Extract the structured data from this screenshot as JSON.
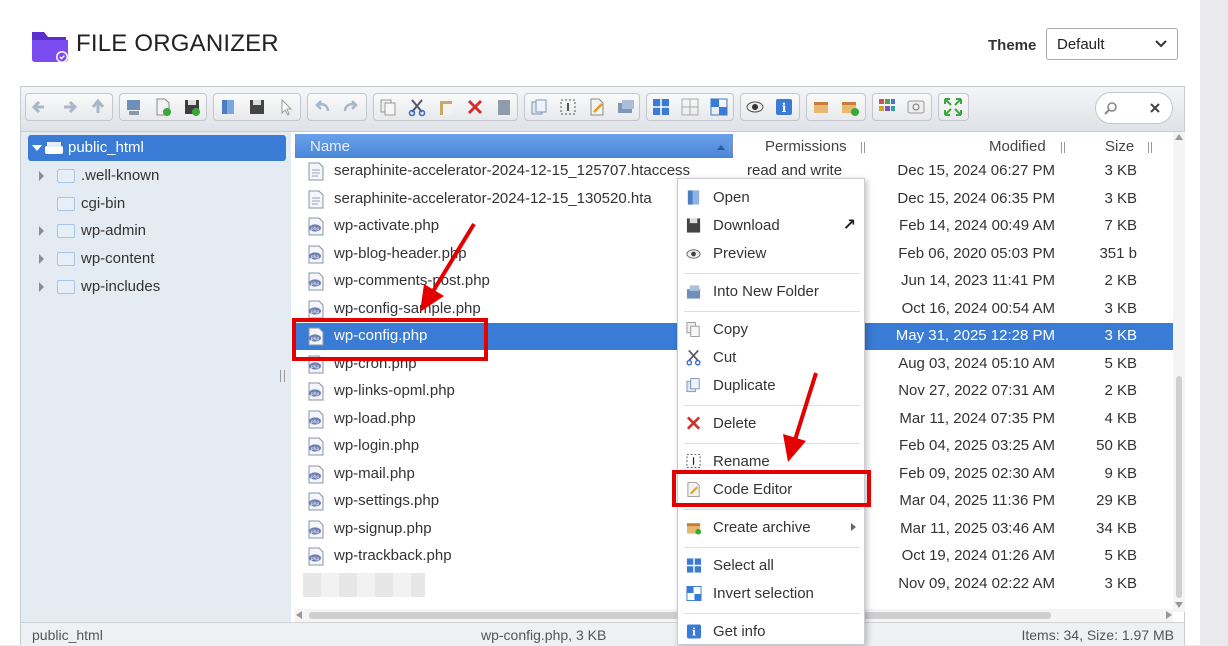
{
  "app": {
    "title": "FILE ORGANIZER"
  },
  "theme": {
    "label": "Theme",
    "value": "Default"
  },
  "tree": {
    "root": "public_html",
    "items": [
      {
        "label": ".well-known",
        "expandable": true
      },
      {
        "label": "cgi-bin",
        "expandable": false
      },
      {
        "label": "wp-admin",
        "expandable": true
      },
      {
        "label": "wp-content",
        "expandable": true
      },
      {
        "label": "wp-includes",
        "expandable": true
      }
    ]
  },
  "columns": {
    "name": "Name",
    "permissions": "Permissions",
    "modified": "Modified",
    "size": "Size"
  },
  "files": [
    {
      "name": "seraphinite-accelerator-2024-12-15_125707.htaccess",
      "perm": "read and write",
      "modified": "Dec 15, 2024 06:27 PM",
      "size": "3 KB",
      "type": "text"
    },
    {
      "name": "seraphinite-accelerator-2024-12-15_130520.hta",
      "perm": "",
      "modified": "Dec 15, 2024 06:35 PM",
      "size": "3 KB",
      "type": "text"
    },
    {
      "name": "wp-activate.php",
      "perm": "",
      "modified": "Feb 14, 2024 00:49 AM",
      "size": "7 KB",
      "type": "php"
    },
    {
      "name": "wp-blog-header.php",
      "perm": "",
      "modified": "Feb 06, 2020 05:03 PM",
      "size": "351 b",
      "type": "php"
    },
    {
      "name": "wp-comments-post.php",
      "perm": "",
      "modified": "Jun 14, 2023 11:41 PM",
      "size": "2 KB",
      "type": "php"
    },
    {
      "name": "wp-config-sample.php",
      "perm": "",
      "modified": "Oct 16, 2024 00:54 AM",
      "size": "3 KB",
      "type": "php"
    },
    {
      "name": "wp-config.php",
      "perm": "",
      "modified": "May 31, 2025 12:28 PM",
      "size": "3 KB",
      "type": "php",
      "selected": true
    },
    {
      "name": "wp-cron.php",
      "perm": "",
      "modified": "Aug 03, 2024 05:10 AM",
      "size": "5 KB",
      "type": "php"
    },
    {
      "name": "wp-links-opml.php",
      "perm": "",
      "modified": "Nov 27, 2022 07:31 AM",
      "size": "2 KB",
      "type": "php"
    },
    {
      "name": "wp-load.php",
      "perm": "",
      "modified": "Mar 11, 2024 07:35 PM",
      "size": "4 KB",
      "type": "php"
    },
    {
      "name": "wp-login.php",
      "perm": "",
      "modified": "Feb 04, 2025 03:25 AM",
      "size": "50 KB",
      "type": "php"
    },
    {
      "name": "wp-mail.php",
      "perm": "",
      "modified": "Feb 09, 2025 02:30 AM",
      "size": "9 KB",
      "type": "php"
    },
    {
      "name": "wp-settings.php",
      "perm": "",
      "modified": "Mar 04, 2025 11:36 PM",
      "size": "29 KB",
      "type": "php"
    },
    {
      "name": "wp-signup.php",
      "perm": "",
      "modified": "Mar 11, 2025 03:46 AM",
      "size": "34 KB",
      "type": "php"
    },
    {
      "name": "wp-trackback.php",
      "perm": "",
      "modified": "Oct 19, 2024 01:26 AM",
      "size": "5 KB",
      "type": "php"
    },
    {
      "name": "",
      "perm": "",
      "modified": "Nov 09, 2024 02:22 AM",
      "size": "3 KB",
      "type": "blurred"
    }
  ],
  "context_menu": [
    {
      "label": "Open",
      "icon": "open-icon"
    },
    {
      "label": "Download",
      "icon": "download-icon",
      "shortcut": "↗"
    },
    {
      "label": "Preview",
      "icon": "preview-icon"
    },
    {
      "sep": true
    },
    {
      "label": "Into New Folder",
      "icon": "into-folder-icon"
    },
    {
      "sep": true
    },
    {
      "label": "Copy",
      "icon": "copy-icon"
    },
    {
      "label": "Cut",
      "icon": "cut-icon"
    },
    {
      "label": "Duplicate",
      "icon": "duplicate-icon"
    },
    {
      "sep": true
    },
    {
      "label": "Delete",
      "icon": "delete-icon"
    },
    {
      "sep": true
    },
    {
      "label": "Rename",
      "icon": "rename-icon"
    },
    {
      "label": "Code Editor",
      "icon": "code-editor-icon",
      "highlight": true
    },
    {
      "sep": true
    },
    {
      "label": "Create archive",
      "icon": "archive-icon",
      "submenu": true
    },
    {
      "sep": true
    },
    {
      "label": "Select all",
      "icon": "select-all-icon"
    },
    {
      "label": "Invert selection",
      "icon": "invert-selection-icon"
    },
    {
      "sep": true
    },
    {
      "label": "Get info",
      "icon": "info-icon"
    }
  ],
  "status": {
    "path": "public_html",
    "selection": "wp-config.php, 3 KB",
    "summary": "Items: 34, Size: 1.97 MB"
  },
  "colors": {
    "accent": "#3a7bd5",
    "annotation": "#e20000",
    "tree_bg": "#e5ebf2"
  }
}
